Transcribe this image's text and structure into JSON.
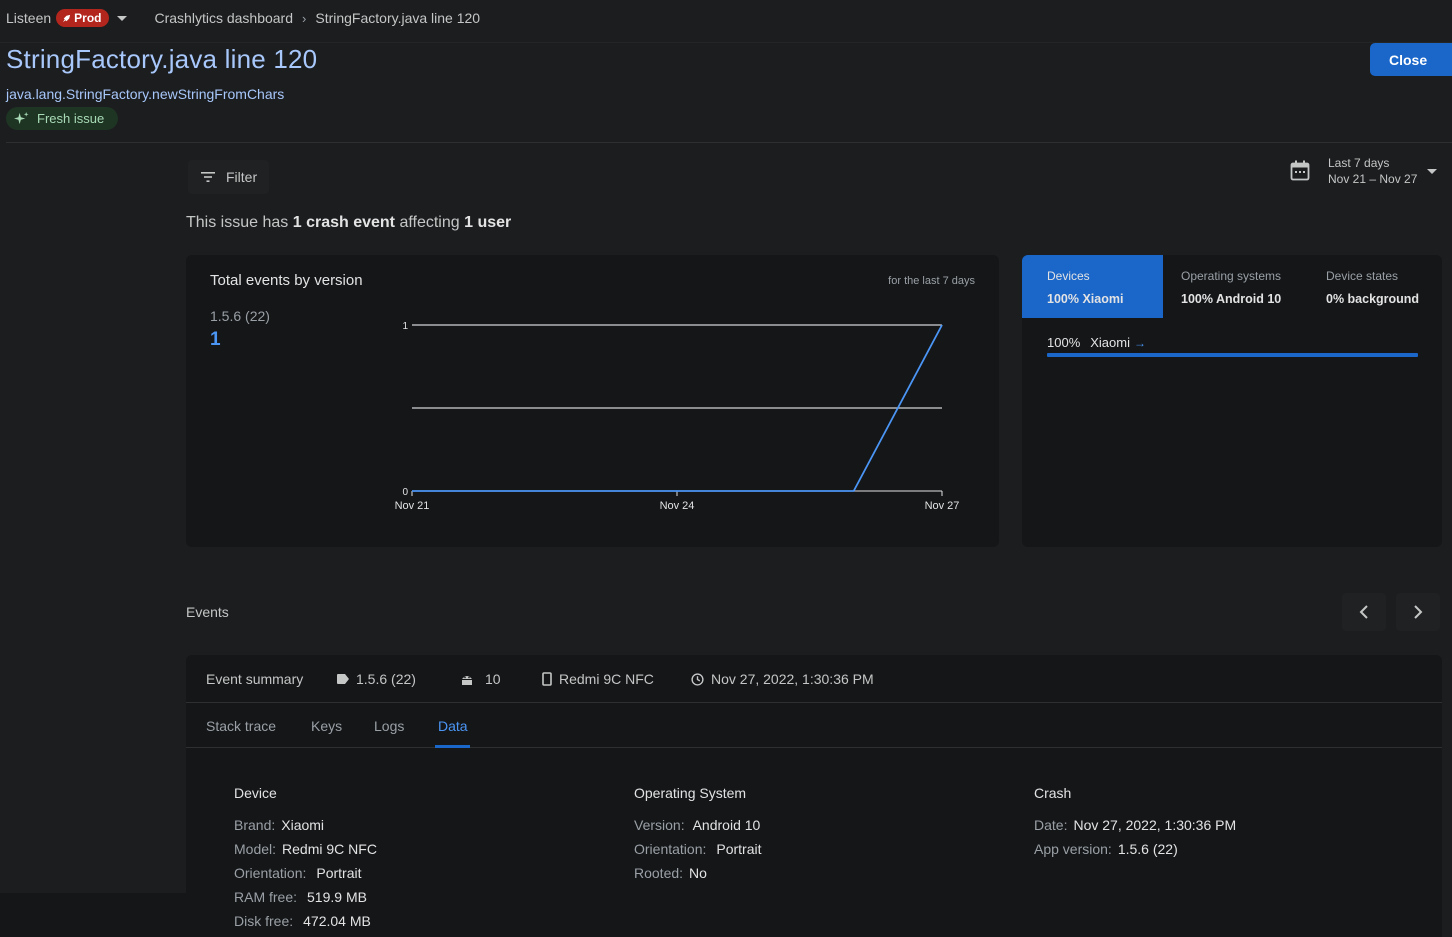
{
  "header": {
    "project": "Listeen",
    "env_badge": "Prod",
    "breadcrumb_root": "Crashlytics dashboard",
    "breadcrumb_current": "StringFactory.java line 120"
  },
  "issue": {
    "title": "StringFactory.java line 120",
    "method": "java.lang.StringFactory.newStringFromChars",
    "badge": "Fresh issue",
    "close_label": "Close"
  },
  "toolbar": {
    "filter_label": "Filter",
    "date_range_label": "Last 7 days",
    "date_range_dates": "Nov 21 – Nov 27"
  },
  "summary": {
    "prefix": "This issue has ",
    "events": "1 crash event",
    "middle": " affecting ",
    "users": "1 user"
  },
  "chart_panel": {
    "title": "Total events by version",
    "range_note": "for the last 7 days",
    "version_label": "1.5.6 (22)",
    "version_count": "1"
  },
  "chart_data": {
    "type": "line",
    "x": [
      "Nov 21",
      "Nov 22",
      "Nov 23",
      "Nov 24",
      "Nov 25",
      "Nov 26",
      "Nov 27"
    ],
    "x_tick_labels": [
      "Nov 21",
      "Nov 24",
      "Nov 27"
    ],
    "y_tick_labels": [
      "0",
      "1"
    ],
    "ylim": [
      0,
      1
    ],
    "series": [
      {
        "name": "1.5.6 (22)",
        "values": [
          0,
          0,
          0,
          0,
          0,
          0,
          1
        ],
        "color": "#4b95f5"
      }
    ],
    "grid": true
  },
  "distribution": {
    "tabs": [
      {
        "label": "Devices",
        "value": "100% Xiaomi",
        "active": true
      },
      {
        "label": "Operating systems",
        "value": "100% Android 10",
        "active": false
      },
      {
        "label": "Device states",
        "value": "0% background",
        "active": false
      }
    ],
    "row_percent": "100%",
    "row_name": "Xiaomi",
    "row_fraction": 1.0
  },
  "events": {
    "label": "Events",
    "summary_label": "Event summary",
    "version": "1.5.6 (22)",
    "os": "10",
    "device": "Redmi 9C NFC",
    "timestamp": "Nov 27, 2022, 1:30:36 PM",
    "tabs": [
      "Stack trace",
      "Keys",
      "Logs",
      "Data"
    ],
    "active_tab": "Data"
  },
  "data_tab": {
    "device": {
      "title": "Device",
      "brand_k": "Brand:",
      "brand_v": "Xiaomi",
      "model_k": "Model:",
      "model_v": "Redmi 9C NFC",
      "orientation_k": "Orientation:",
      "orientation_v": "Portrait",
      "ram_k": "RAM free:",
      "ram_v": "519.9 MB",
      "disk_k": "Disk free:",
      "disk_v": "472.04 MB"
    },
    "os": {
      "title": "Operating System",
      "version_k": "Version:",
      "version_v": "Android 10",
      "orientation_k": "Orientation:",
      "orientation_v": "Portrait",
      "rooted_k": "Rooted:",
      "rooted_v": "No"
    },
    "crash": {
      "title": "Crash",
      "date_k": "Date:",
      "date_v": "Nov 27, 2022, 1:30:36 PM",
      "appver_k": "App version:",
      "appver_v": "1.5.6 (22)"
    }
  },
  "colors": {
    "accent": "#1a66c9",
    "link": "#a8c7fa",
    "badge_red": "#b3261e",
    "fresh_green": "#a8dab5"
  }
}
